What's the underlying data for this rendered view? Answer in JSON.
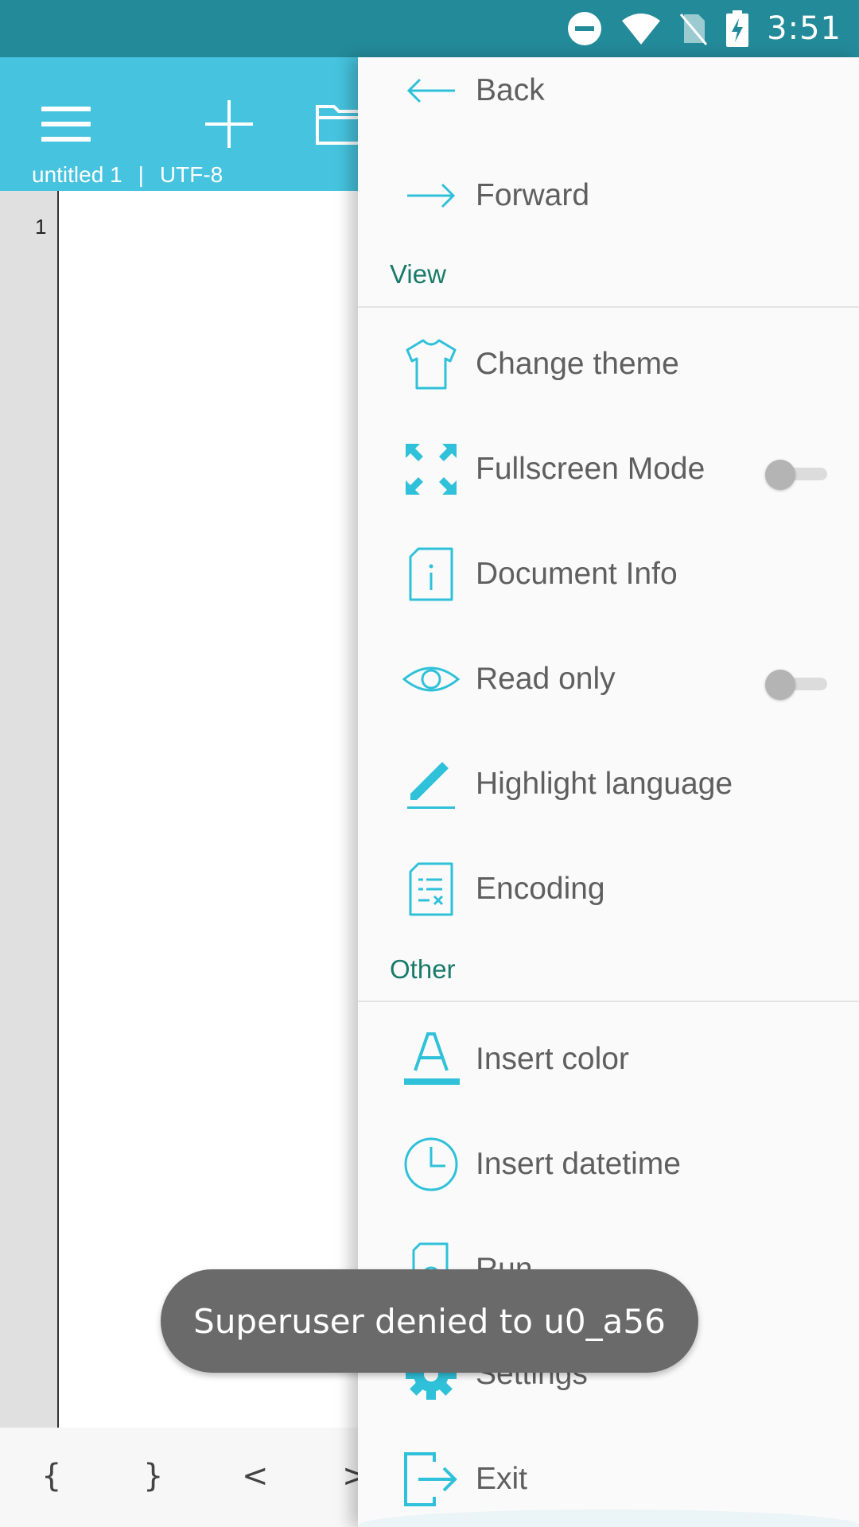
{
  "status_bar": {
    "time": "3:51"
  },
  "toolbar": {
    "file_name": "untitled 1",
    "separator": "|",
    "encoding": "UTF-8"
  },
  "editor": {
    "line_number": "1"
  },
  "symbol_bar": {
    "symbols": [
      "{",
      "}",
      "<",
      ">"
    ]
  },
  "drawer": {
    "items_top": [
      {
        "label": "Back",
        "icon": "arrow-left-icon"
      },
      {
        "label": "Forward",
        "icon": "arrow-right-icon"
      }
    ],
    "sections": [
      {
        "title": "View",
        "items": [
          {
            "label": "Change theme",
            "icon": "shirt-icon"
          },
          {
            "label": "Fullscreen Mode",
            "icon": "fullscreen-icon",
            "toggle": false
          },
          {
            "label": "Document Info",
            "icon": "info-document-icon"
          },
          {
            "label": "Read only",
            "icon": "eye-icon",
            "toggle": false
          },
          {
            "label": "Highlight language",
            "icon": "pen-icon"
          },
          {
            "label": "Encoding",
            "icon": "encoding-document-icon"
          }
        ]
      },
      {
        "title": "Other",
        "items": [
          {
            "label": "Insert color",
            "icon": "text-color-icon"
          },
          {
            "label": "Insert datetime",
            "icon": "clock-icon"
          },
          {
            "label": "Run",
            "icon": "search-document-icon"
          },
          {
            "label": "Settings",
            "icon": "gear-icon"
          },
          {
            "label": "Exit",
            "icon": "exit-icon"
          }
        ]
      }
    ]
  },
  "toast": {
    "message": "Superuser denied to u0_a56"
  },
  "colors": {
    "status_bar": "#238a99",
    "toolbar": "#46c3de",
    "accent_icon": "#2fc1d9",
    "section_title": "#1a7b6b"
  }
}
